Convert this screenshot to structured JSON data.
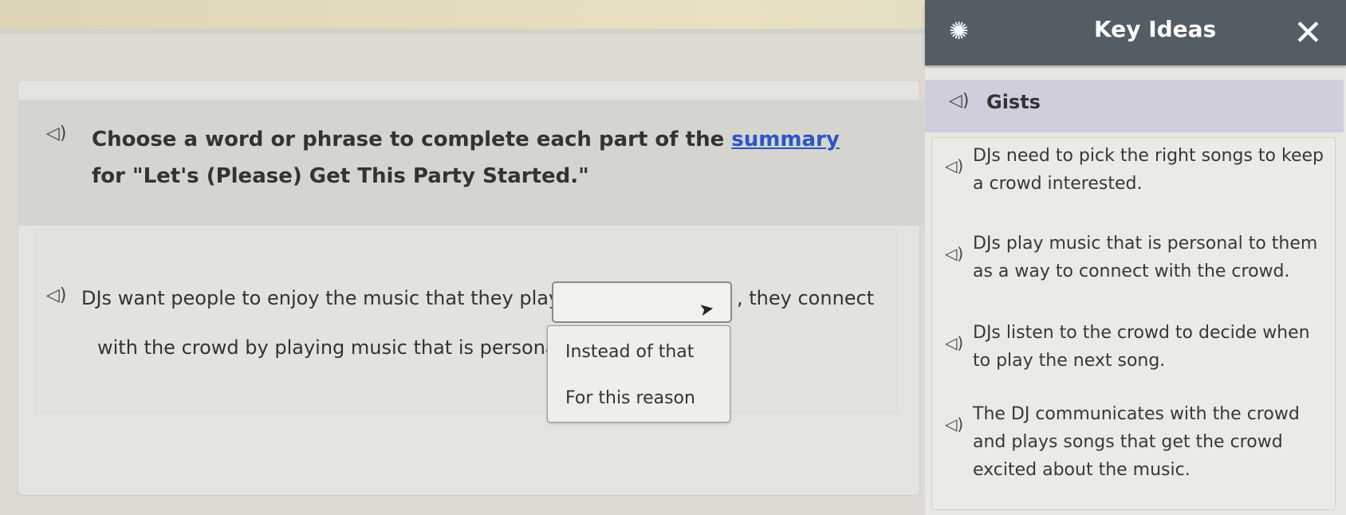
{
  "instruction": {
    "prefix": "Choose a word or phrase to complete each part of the ",
    "link": "summary",
    "suffix": " for \"Let's (Please) Get This Party Started.\""
  },
  "sentence": {
    "part1": "DJs want people to enjoy the music that they play.",
    "part2": ", they connect",
    "part3": "with the crowd by playing music that is personal to"
  },
  "dropdown": {
    "selected": "",
    "options": [
      "Instead of that",
      "For this reason"
    ]
  },
  "panel": {
    "title": "Key Ideas",
    "close_glyph": "✕",
    "section_label": "Gists",
    "gists": [
      "DJs need to pick the right songs to keep a crowd interested.",
      "DJs play music that is personal to them as a way to connect with the crowd.",
      "DJs listen to the crowd to decide when to play the next song.",
      "The DJ communicates with the crowd and plays songs that get the crowd excited about the music."
    ]
  },
  "icons": {
    "speaker": "speaker-icon",
    "bulb": "lightbulb-icon",
    "close": "close-icon",
    "cursor": "mouse-cursor-icon"
  },
  "colors": {
    "link": "#2a56c6",
    "header": "#555d64",
    "gists_band": "#cfcedd"
  }
}
